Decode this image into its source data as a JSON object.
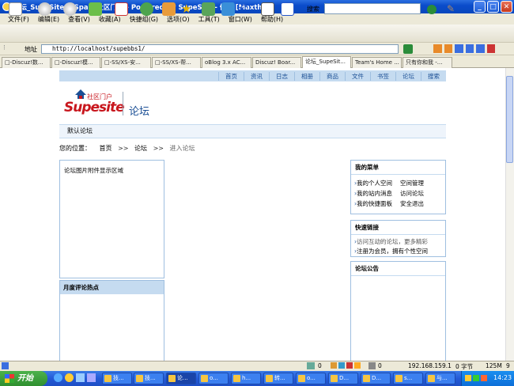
{
  "window": {
    "title": "论坛_SupeSite/X-Space社区门户 - Powered By SupeSite - 傲游 [Maxthon]"
  },
  "menu": [
    "文件(F)",
    "编辑(E)",
    "查看(V)",
    "收藏(A)",
    "快捷组(G)",
    "选项(O)",
    "工具(T)",
    "窗口(W)",
    "帮助(H)"
  ],
  "toolbar": {
    "search_label": "搜索",
    "search_value": ""
  },
  "address": {
    "label": "地址",
    "url": "http://localhost/supebbs1/"
  },
  "tabs": [
    "□-Discuz!数...",
    "□-Discuz!模...",
    "□-SS/XS-安...",
    "□-SS/XS-帮...",
    "oBlog 3.x AC...",
    "Discuz! Boar...",
    "论坛_SupeSit...",
    "Team's Home ...",
    "只有你和我 -..."
  ],
  "active_tab": 6,
  "site": {
    "nav": [
      "首页",
      "资讯",
      "日志",
      "相册",
      "商品",
      "文件",
      "书签",
      "论坛",
      "搜索"
    ],
    "logo_sub": "社区门户",
    "logo_main": "Supesite",
    "section_title": "论坛",
    "subnav": "默认论坛",
    "breadcrumb": {
      "label": "您的位置：",
      "home": "首页",
      "sep": ">>",
      "forum": "论坛",
      "current": "进入论坛"
    },
    "attach_text": "论坛图片附件显示区域",
    "hot_title": "月度评论热点",
    "my_menu": {
      "title": "我的菜单",
      "rows": [
        [
          "我的个人空间",
          "空间管理"
        ],
        [
          "我的站内消息",
          "访问论坛"
        ],
        [
          "我的快捷面板",
          "安全退出"
        ]
      ]
    },
    "quick_links": {
      "title": "快速链接",
      "items": [
        "访问互动的论坛，更多精彩",
        "注册为会员，拥有个性空间"
      ]
    },
    "notice_title": "论坛公告"
  },
  "status": {
    "ip": "192.168.159.1",
    "bytes": "0 字节",
    "mem": "125M",
    "count": "9",
    "zero": "0"
  },
  "taskbar": {
    "start": "开始",
    "tasks": [
      "技...",
      "技...",
      "论...",
      "o...",
      "h...",
      "转...",
      "o...",
      "D...",
      "D...",
      "s...",
      "与..."
    ],
    "clock": "14:23"
  },
  "colors": {
    "titlebar": "#0b4ccb",
    "nav_bg": "#c5dbf0",
    "logo_red": "#c8161d",
    "link_blue": "#1b4f95"
  }
}
